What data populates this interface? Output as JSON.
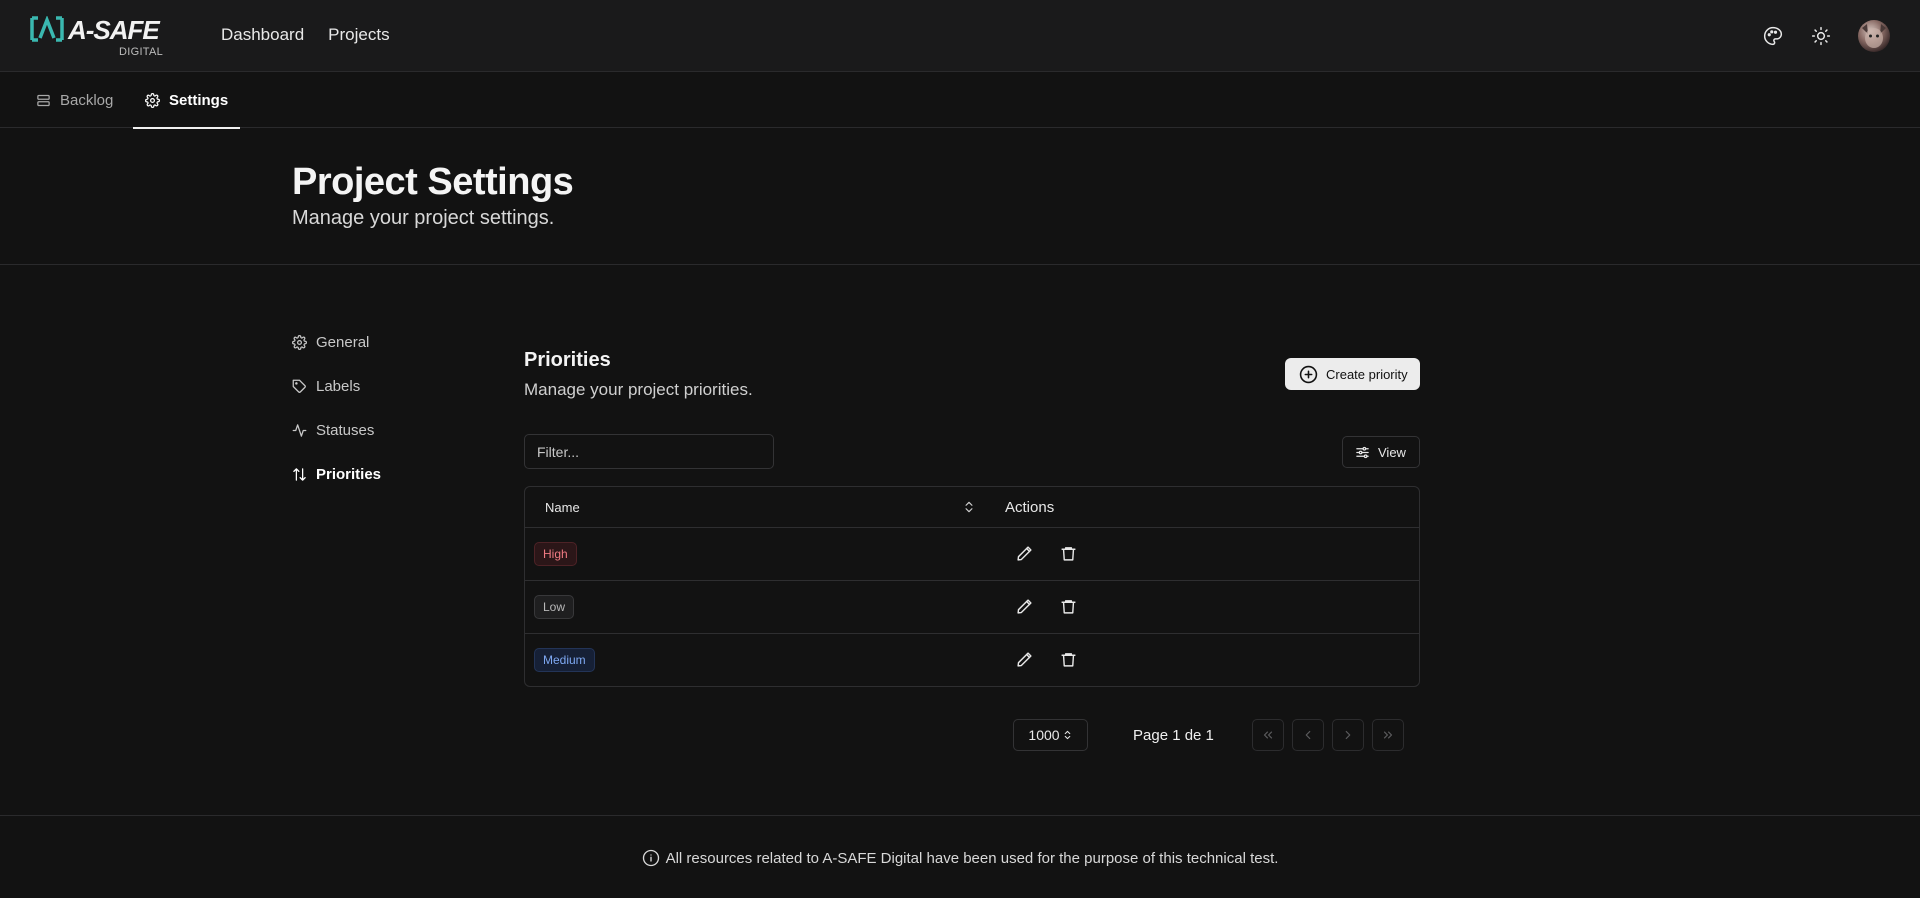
{
  "header": {
    "brand": "A-SAFE",
    "brand_sub": "DIGITAL",
    "nav": [
      "Dashboard",
      "Projects"
    ]
  },
  "tabs": [
    {
      "label": "Backlog",
      "icon": "list-icon",
      "active": false
    },
    {
      "label": "Settings",
      "icon": "gear-icon",
      "active": true
    }
  ],
  "page": {
    "title": "Project Settings",
    "subtitle": "Manage your project settings."
  },
  "sidebar": {
    "items": [
      {
        "label": "General",
        "icon": "gear-icon",
        "active": false
      },
      {
        "label": "Labels",
        "icon": "tag-icon",
        "active": false
      },
      {
        "label": "Statuses",
        "icon": "activity-icon",
        "active": false
      },
      {
        "label": "Priorities",
        "icon": "sort-arrows-icon",
        "active": true
      }
    ]
  },
  "section": {
    "title": "Priorities",
    "subtitle": "Manage your project priorities.",
    "create_label": "Create priority"
  },
  "toolbar": {
    "filter_placeholder": "Filter...",
    "view_label": "View"
  },
  "table": {
    "columns": [
      "Name",
      "Actions"
    ],
    "rows": [
      {
        "name": "High",
        "style": "high"
      },
      {
        "name": "Low",
        "style": "low"
      },
      {
        "name": "Medium",
        "style": "medium"
      }
    ]
  },
  "pagination": {
    "page_size": "1000",
    "page_info": "Page 1 de 1"
  },
  "footer": {
    "text": "All resources related to A-SAFE Digital have been used for the purpose of this technical test."
  },
  "colors": {
    "background": "#121212",
    "high": "#f07a82",
    "medium": "#7ea8f2",
    "logo_accent": "#3ab8b0"
  }
}
